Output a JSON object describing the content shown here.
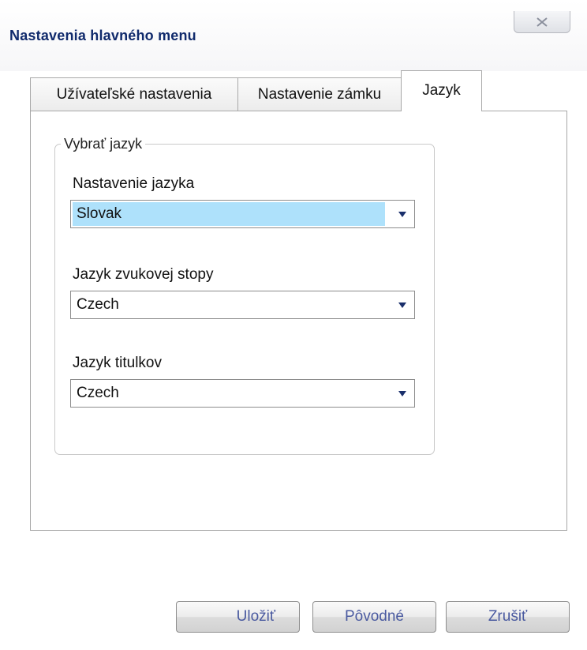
{
  "window": {
    "title": "Nastavenia hlavného menu",
    "close_icon": "close-x-icon"
  },
  "tabs": [
    {
      "label": "Užívateľské nastavenia",
      "active": false
    },
    {
      "label": "Nastavenie zámku",
      "active": false
    },
    {
      "label": "Jazyk",
      "active": true
    }
  ],
  "group": {
    "title": "Vybrať jazyk",
    "fields": [
      {
        "label": "Nastavenie jazyka",
        "value": "Slovak",
        "focused": true
      },
      {
        "label": "Jazyk zvukovej stopy",
        "value": "Czech",
        "focused": false
      },
      {
        "label": "Jazyk titulkov",
        "value": "Czech",
        "focused": false
      }
    ]
  },
  "buttons": {
    "save": "Uložiť",
    "default": "Pôvodné",
    "cancel": "Zrušiť"
  },
  "colors": {
    "title_text": "#102a6c",
    "selection_highlight": "#aee1fb",
    "button_text": "#4a5aa0"
  }
}
